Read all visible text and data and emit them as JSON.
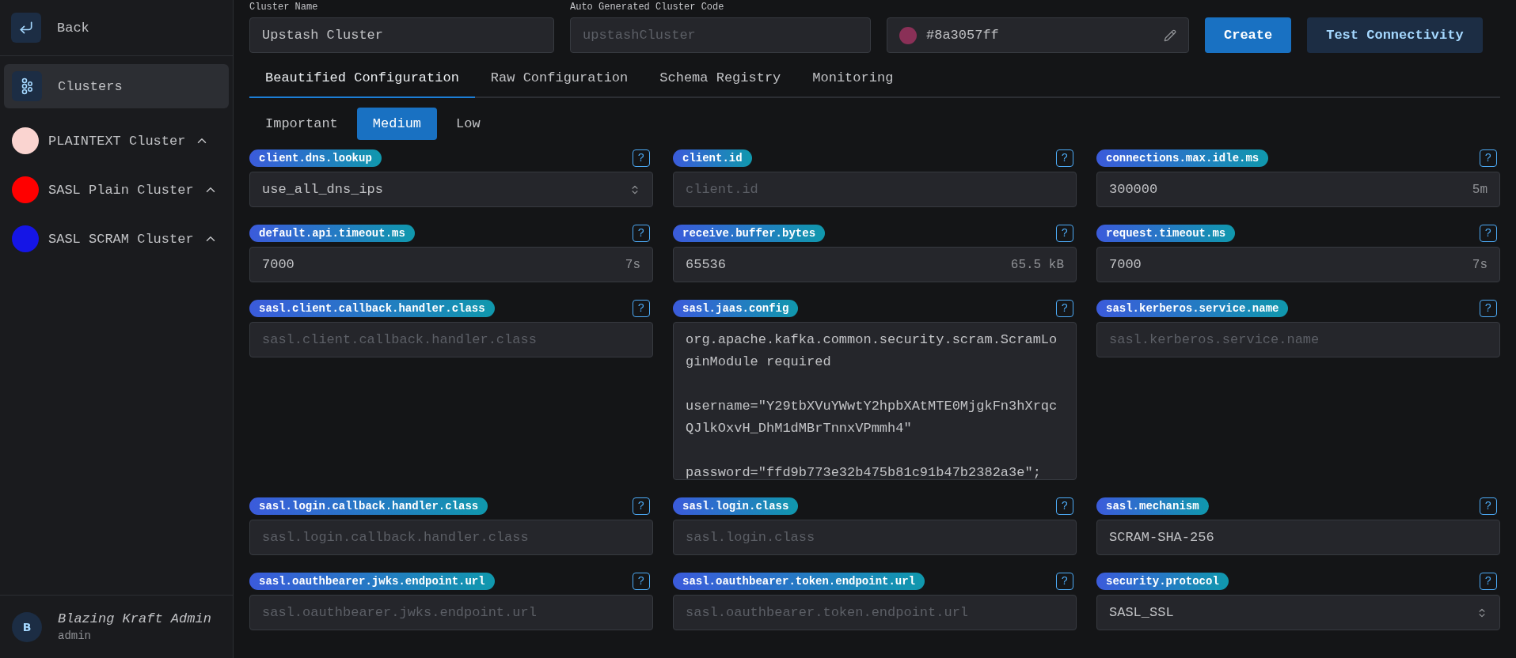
{
  "sidebar": {
    "back": {
      "label": "Back"
    },
    "nav": [
      {
        "label": "Clusters",
        "selected": true
      }
    ],
    "clusters": [
      {
        "name": "PLAINTEXT Cluster",
        "color": "#fad4d0",
        "expanded": false
      },
      {
        "name": "SASL Plain Cluster",
        "color": "#ff0000",
        "expanded": false
      },
      {
        "name": "SASL SCRAM Cluster",
        "color": "#1515e6",
        "expanded": false
      }
    ],
    "user": {
      "initial": "B",
      "name": "Blazing Kraft Admin",
      "role": "admin"
    }
  },
  "header": {
    "name_field": {
      "label": "Cluster Name",
      "value": "Upstash Cluster"
    },
    "code_field": {
      "label": "Auto Generated Cluster Code",
      "placeholder": "upstashCluster"
    },
    "color_field": {
      "color": "#8a3057",
      "value": "#8a3057ff"
    },
    "buttons": [
      {
        "label": "Create",
        "kind": "primary"
      },
      {
        "label": "Test Connectivity",
        "kind": "secondary"
      }
    ]
  },
  "tabs": [
    {
      "label": "Beautified Configuration",
      "selected": true
    },
    {
      "label": "Raw Configuration",
      "selected": false
    },
    {
      "label": "Schema Registry",
      "selected": false
    },
    {
      "label": "Monitoring",
      "selected": false
    }
  ],
  "subtabs": [
    {
      "label": "Important",
      "selected": false
    },
    {
      "label": "Medium",
      "selected": true
    },
    {
      "label": "Low",
      "selected": false
    }
  ],
  "fields": [
    {
      "key": "client.dns.lookup",
      "kind": "select",
      "value": "use_all_dns_ips",
      "help": "?"
    },
    {
      "key": "client.id",
      "kind": "text",
      "placeholder": "client.id",
      "help": "?"
    },
    {
      "key": "connections.max.idle.ms",
      "kind": "text",
      "value": "300000",
      "suffix": "5m",
      "help": "?"
    },
    {
      "key": "default.api.timeout.ms",
      "kind": "text",
      "value": "7000",
      "suffix": "7s",
      "help": "?"
    },
    {
      "key": "receive.buffer.bytes",
      "kind": "text",
      "value": "65536",
      "suffix": "65.5 kB",
      "help": "?"
    },
    {
      "key": "request.timeout.ms",
      "kind": "text",
      "value": "7000",
      "suffix": "7s",
      "help": "?"
    },
    {
      "key": "sasl.client.callback.handler.class",
      "kind": "text",
      "placeholder": "sasl.client.callback.handler.class",
      "help": "?"
    },
    {
      "key": "sasl.jaas.config",
      "kind": "textarea",
      "lines": [
        "org.apache.kafka.common.security.scram.ScramLoginModule required",
        "username=\"Y29tbXVuYWwtY2hpbXAtMTE0MjgkFn3hXrqcQJlkOxvH_DhM1dMBrTnnxVPmmh4\"",
        "password=\"ffd9b773e32b475b81c91b47b2382a3e\";"
      ],
      "help": "?"
    },
    {
      "key": "sasl.kerberos.service.name",
      "kind": "text",
      "placeholder": "sasl.kerberos.service.name",
      "help": "?"
    },
    {
      "key": "sasl.login.callback.handler.class",
      "kind": "text",
      "placeholder": "sasl.login.callback.handler.class",
      "help": "?"
    },
    {
      "key": "sasl.login.class",
      "kind": "text",
      "placeholder": "sasl.login.class",
      "help": "?"
    },
    {
      "key": "sasl.mechanism",
      "kind": "text",
      "value": "SCRAM-SHA-256",
      "help": "?"
    },
    {
      "key": "sasl.oauthbearer.jwks.endpoint.url",
      "kind": "text",
      "placeholder": "sasl.oauthbearer.jwks.endpoint.url",
      "help": "?"
    },
    {
      "key": "sasl.oauthbearer.token.endpoint.url",
      "kind": "text",
      "placeholder": "sasl.oauthbearer.token.endpoint.url",
      "help": "?"
    },
    {
      "key": "security.protocol",
      "kind": "select",
      "value": "SASL_SSL",
      "help": "?"
    }
  ]
}
